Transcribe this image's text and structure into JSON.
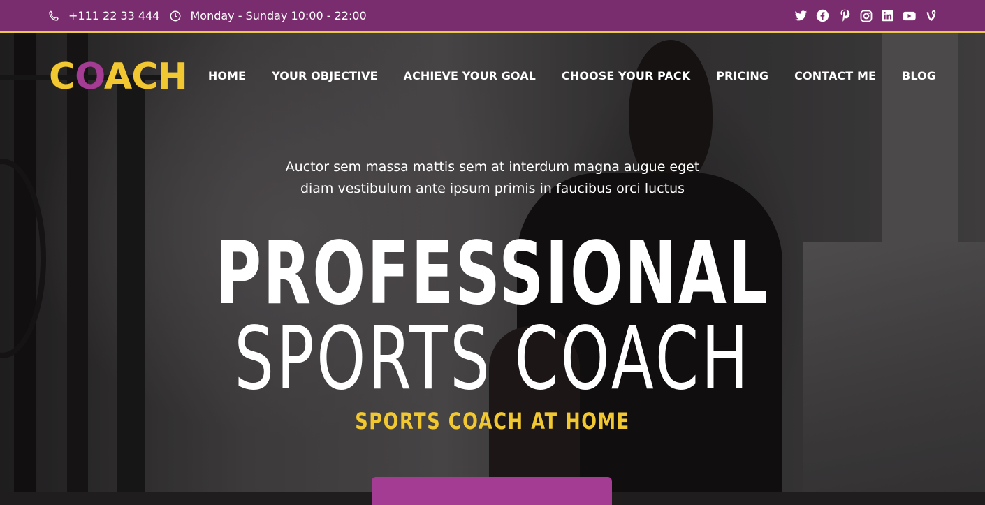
{
  "topbar": {
    "phone": "+111 22 33 444",
    "hours": "Monday - Sunday 10:00 - 22:00",
    "icons": [
      "phone-icon",
      "clock-icon"
    ],
    "social": [
      "twitter-icon",
      "facebook-icon",
      "pinterest-icon",
      "instagram-icon",
      "linkedin-icon",
      "youtube-icon",
      "vine-icon"
    ]
  },
  "header": {
    "logo": {
      "c": "C",
      "o": "O",
      "rest": "ACH"
    },
    "nav": [
      "HOME",
      "YOUR OBJECTIVE",
      "ACHIEVE YOUR GOAL",
      "CHOOSE YOUR PACK",
      "PRICING",
      "CONTACT ME",
      "BLOG"
    ]
  },
  "hero": {
    "tagline": "Auctor sem massa mattis sem at interdum magna augue eget diam vestibulum ante ipsum primis in faucibus orci luctus",
    "title_line1": "PROFESSIONAL",
    "title_line2": "SPORTS COACH",
    "subtitle": "SPORTS COACH AT HOME"
  },
  "colors": {
    "topbar": "#7a2d6e",
    "accent_yellow": "#f2c832",
    "accent_purple": "#a33c92"
  }
}
